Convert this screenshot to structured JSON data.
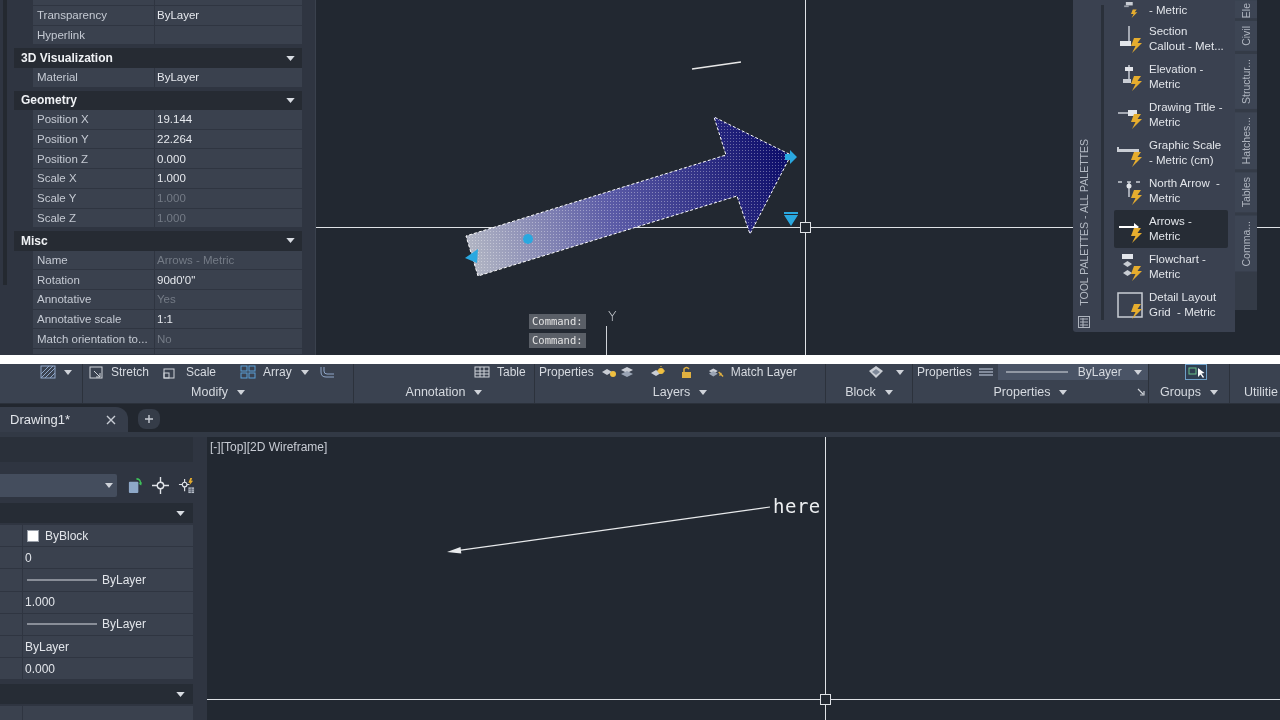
{
  "top_view": {
    "properties": {
      "rows": [
        {
          "label": "Transparency",
          "value": "ByLayer",
          "disabled": false
        },
        {
          "label": "Hyperlink"
        }
      ],
      "sections": [
        {
          "title": "3D Visualization",
          "expanded": true,
          "rows": [
            {
              "label": "Material",
              "value": "ByLayer",
              "disabled": false
            }
          ]
        },
        {
          "title": "Geometry",
          "expanded": true,
          "rows": [
            {
              "label": "Position X",
              "value": "19.144",
              "disabled": false
            },
            {
              "label": "Position Y",
              "value": "22.264",
              "disabled": false
            },
            {
              "label": "Position Z",
              "value": "0.000",
              "disabled": false
            },
            {
              "label": "Scale X",
              "value": "1.000",
              "disabled": false
            },
            {
              "label": "Scale Y",
              "value": "1.000",
              "disabled": true
            },
            {
              "label": "Scale Z",
              "value": "1.000",
              "disabled": true
            }
          ]
        },
        {
          "title": "Misc",
          "expanded": true,
          "rows": [
            {
              "label": "Name",
              "value": "Arrows - Metric",
              "disabled": true
            },
            {
              "label": "Rotation",
              "value": "90d0'0\"",
              "disabled": false
            },
            {
              "label": "Annotative",
              "value": "Yes",
              "disabled": true
            },
            {
              "label": "Annotative scale",
              "value": "1:1",
              "disabled": false
            },
            {
              "label": "Match orientation to...",
              "value": "No",
              "disabled": true
            }
          ]
        }
      ]
    },
    "canvas": {
      "command_lines": [
        "Command:",
        "Command:"
      ],
      "ucs_label": "Y"
    },
    "tool_palette": {
      "title": "TOOL PALETTES - ALL PALETTES",
      "items": [
        {
          "label": "- Metric",
          "selected": false
        },
        {
          "label": "Section\nCallout - Met...",
          "selected": false
        },
        {
          "label": "Elevation -\nMetric",
          "selected": false
        },
        {
          "label": "Drawing Title -\nMetric",
          "selected": false
        },
        {
          "label": "Graphic Scale\n- Metric (cm)",
          "selected": false
        },
        {
          "label": "North Arrow  -\nMetric",
          "selected": false
        },
        {
          "label": "Arrows -\nMetric",
          "selected": true
        },
        {
          "label": "Flowchart -\nMetric",
          "selected": false
        },
        {
          "label": "Detail Layout\nGrid  - Metric",
          "selected": false
        }
      ],
      "tabs": [
        {
          "label": "Ele",
          "selected": false
        },
        {
          "label": "Civil",
          "selected": false
        },
        {
          "label": "Structur...",
          "selected": false
        },
        {
          "label": "Hatches...",
          "selected": false
        },
        {
          "label": "Tables",
          "selected": false
        },
        {
          "label": "Comma...",
          "selected": false
        }
      ]
    }
  },
  "bottom_view": {
    "ribbon": {
      "panels": [
        {
          "label": "Modify",
          "tools": [
            "Stretch",
            "Scale",
            "Array"
          ]
        },
        {
          "label": "Annotation",
          "tools": [
            "Table"
          ]
        },
        {
          "label": "Layers",
          "tools": [
            "Properties",
            "Match Layer"
          ]
        },
        {
          "label": "Block"
        },
        {
          "label": "Properties",
          "tools": [
            "Properties"
          ],
          "dropdown": "ByLayer"
        },
        {
          "label": "Groups"
        },
        {
          "label": "Utilitie"
        }
      ]
    },
    "file_tabs": [
      {
        "label": "Drawing1*",
        "selected": true
      }
    ],
    "properties": {
      "sections": [
        {
          "expanded": true,
          "rows": [
            {
              "kind": "color",
              "value": "ByBlock"
            },
            {
              "kind": "text",
              "value": "0"
            },
            {
              "kind": "linetype",
              "value": "ByLayer"
            },
            {
              "kind": "text",
              "value": "1.000"
            },
            {
              "kind": "linetype",
              "value": "ByLayer"
            },
            {
              "kind": "text",
              "value": "ByLayer"
            },
            {
              "kind": "text",
              "value": "0.000"
            }
          ]
        },
        {
          "expanded": true
        }
      ]
    },
    "viewport": {
      "label": "[-][Top][2D Wireframe]",
      "drawing_text": "here"
    }
  }
}
